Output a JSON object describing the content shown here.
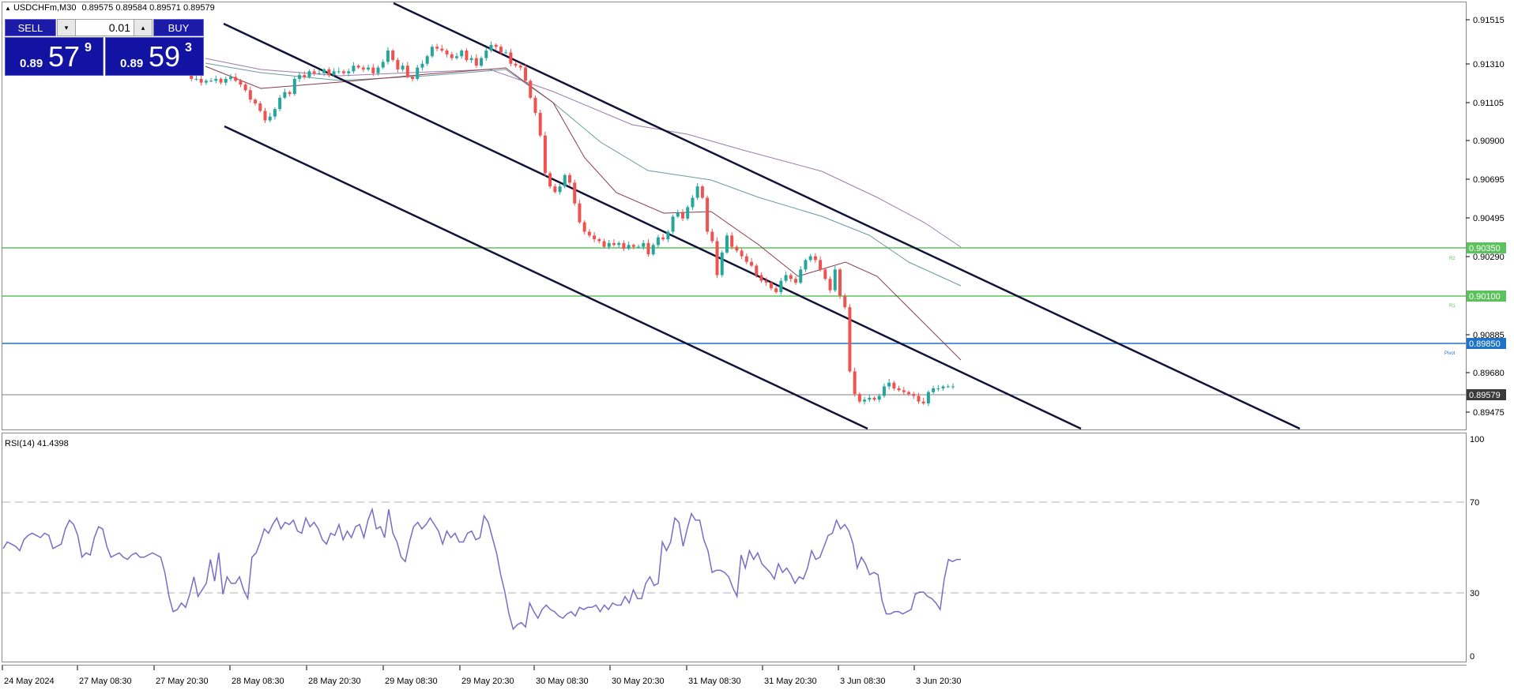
{
  "header": {
    "title": "USDCHFm,M30",
    "ohlc": "0.89575 0.89584 0.89571 0.89579"
  },
  "trade_panel": {
    "sell_label": "SELL",
    "buy_label": "BUY",
    "lot_value": "0.01",
    "down_arrow": "▾",
    "up_arrow": "▴",
    "sell_price": {
      "prefix": "0.89",
      "big": "57",
      "sup": "9"
    },
    "buy_price": {
      "prefix": "0.89",
      "big": "59",
      "sup": "3"
    }
  },
  "price_axis": {
    "labels": [
      "0.91515",
      "0.91310",
      "0.91105",
      "0.90900",
      "0.90695",
      "0.90495",
      "0.90290",
      "0.90885",
      "0.89680",
      "0.89475"
    ],
    "tags": [
      {
        "value": "0.90350",
        "color": "#5cc35c",
        "level_label": "R2"
      },
      {
        "value": "0.90100",
        "color": "#5cc35c",
        "level_label": "R1"
      },
      {
        "value": "0.89850",
        "color": "#1e73c8",
        "level_label": "Pivot"
      },
      {
        "value": "0.89579",
        "color": "#3a3a3a",
        "level_label": ""
      }
    ]
  },
  "rsi": {
    "label": "RSI(14) 41.4398",
    "axis_labels": [
      "100",
      "70",
      "30",
      "0"
    ],
    "levels": [
      70,
      30
    ],
    "color": "#7b6bc7",
    "values": [
      49,
      52,
      51,
      50,
      48,
      53,
      55,
      56,
      55,
      54,
      56,
      55,
      49,
      50,
      51,
      58,
      62,
      60,
      55,
      45,
      47,
      46,
      54,
      59,
      58,
      50,
      45,
      46,
      47,
      45,
      44,
      46,
      47,
      45,
      45,
      46,
      47,
      46,
      45,
      38,
      27,
      20,
      21,
      24,
      22,
      28,
      36,
      27,
      30,
      33,
      44,
      34,
      47,
      28,
      36,
      33,
      33,
      36,
      30,
      26,
      45,
      47,
      52,
      58,
      56,
      60,
      63,
      58,
      61,
      60,
      62,
      57,
      56,
      63,
      59,
      61,
      58,
      53,
      51,
      56,
      55,
      60,
      53,
      57,
      54,
      59,
      60,
      54,
      62,
      67,
      58,
      59,
      54,
      67,
      56,
      52,
      45,
      43,
      52,
      59,
      61,
      58,
      60,
      63,
      60,
      57,
      51,
      57,
      54,
      56,
      52,
      52,
      56,
      57,
      53,
      54,
      64,
      61,
      54,
      47,
      37,
      29,
      19,
      12,
      14,
      15,
      13,
      24,
      20,
      17,
      21,
      23,
      21,
      20,
      18,
      17,
      19,
      20,
      18,
      22,
      21,
      22,
      22,
      23,
      20,
      23,
      21,
      24,
      23,
      23,
      27,
      24,
      30,
      26,
      26,
      33,
      36,
      32,
      33,
      52,
      48,
      52,
      63,
      61,
      50,
      58,
      65,
      62,
      62,
      53,
      48,
      38,
      39,
      39,
      38,
      36,
      31,
      27,
      46,
      40,
      48,
      44,
      47,
      42,
      40,
      38,
      35,
      42,
      38,
      40,
      37,
      33,
      36,
      35,
      40,
      48,
      44,
      45,
      50,
      55,
      56,
      62,
      58,
      60,
      57,
      51,
      40,
      45,
      42,
      37,
      38,
      37,
      25,
      19,
      19,
      20,
      20,
      19,
      20,
      21,
      28,
      29,
      29,
      27,
      26,
      24,
      21,
      35,
      44,
      43,
      44,
      44
    ]
  },
  "time_axis": {
    "labels": [
      "24 May 2024",
      "27 May 08:30",
      "27 May 20:30",
      "28 May 08:30",
      "28 May 20:30",
      "29 May 08:30",
      "29 May 20:30",
      "30 May 08:30",
      "30 May 20:30",
      "31 May 08:30",
      "31 May 20:30",
      "3 Jun 08:30",
      "3 Jun 20:30"
    ]
  },
  "chart_data": {
    "type": "candlestick",
    "symbol": "USDCHFm",
    "timeframe": "M30",
    "bull_color": "#26a69a",
    "bear_color": "#ef5350",
    "closes": [
      0.9124,
      0.9121,
      0.9121,
      0.9119,
      0.912,
      0.912,
      0.9121,
      0.9119,
      0.9121,
      0.9122,
      0.912,
      0.9118,
      0.9115,
      0.911,
      0.9108,
      0.9104,
      0.9099,
      0.9101,
      0.9105,
      0.9111,
      0.9114,
      0.9113,
      0.9121,
      0.9123,
      0.9122,
      0.9125,
      0.9124,
      0.9124,
      0.9126,
      0.9123,
      0.9125,
      0.9125,
      0.9124,
      0.9125,
      0.9128,
      0.9127,
      0.9126,
      0.9127,
      0.9124,
      0.9127,
      0.913,
      0.9136,
      0.9131,
      0.9126,
      0.9128,
      0.9122,
      0.9121,
      0.9127,
      0.9129,
      0.9133,
      0.9138,
      0.9137,
      0.9136,
      0.9134,
      0.9132,
      0.9133,
      0.9136,
      0.9131,
      0.9132,
      0.9128,
      0.9132,
      0.9136,
      0.9139,
      0.9138,
      0.9135,
      0.9135,
      0.9129,
      0.9128,
      0.9127,
      0.912,
      0.9111,
      0.9103,
      0.9091,
      0.9071,
      0.9064,
      0.9061,
      0.9064,
      0.907,
      0.9066,
      0.9055,
      0.9045,
      0.904,
      0.9038,
      0.9036,
      0.9035,
      0.9032,
      0.9034,
      0.9033,
      0.9034,
      0.9031,
      0.9033,
      0.9032,
      0.9032,
      0.9034,
      0.9028,
      0.9033,
      0.9037,
      0.9036,
      0.904,
      0.9048,
      0.905,
      0.9047,
      0.9053,
      0.9058,
      0.9064,
      0.9058,
      0.904,
      0.9035,
      0.9017,
      0.9029,
      0.9038,
      0.9032,
      0.903,
      0.9027,
      0.9024,
      0.9022,
      0.9017,
      0.9014,
      0.9013,
      0.901,
      0.9008,
      0.9014,
      0.9017,
      0.9015,
      0.9013,
      0.902,
      0.9025,
      0.9027,
      0.9025,
      0.902,
      0.9015,
      0.9009,
      0.902,
      0.9006,
      0.9,
      0.8966,
      0.8954,
      0.895,
      0.8951,
      0.8952,
      0.8951,
      0.8953,
      0.8958,
      0.896,
      0.8957,
      0.8956,
      0.8955,
      0.8954,
      0.8953,
      0.895,
      0.8949,
      0.8955,
      0.8957,
      0.8957,
      0.8958,
      0.8958,
      0.8958
    ]
  }
}
